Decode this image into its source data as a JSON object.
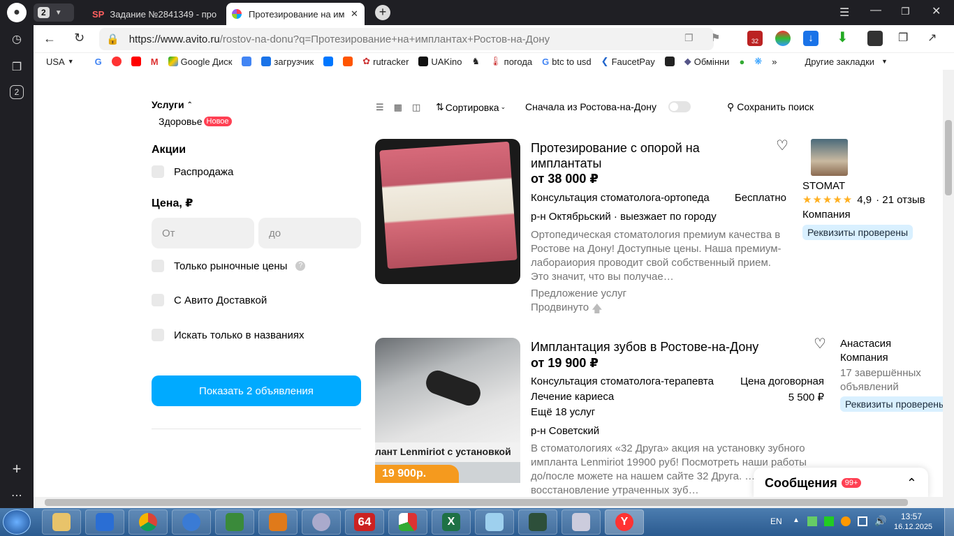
{
  "browser": {
    "tab_count": "2",
    "tabs": [
      {
        "label": "Задание №2841349 - про"
      },
      {
        "label": "Протезирование на им"
      }
    ],
    "url_domain": "https://www.avito.ru",
    "url_path": "/rostov-na-donu?q=Протезирование+на+имплантах+Ростов-на-Дону",
    "sidebar_badge": "2",
    "bookmarks": [
      "USA",
      "Google Диск",
      "загрузчик",
      "rutracker",
      "UAKino",
      "погода",
      "btc to usd",
      "FaucetPay",
      "Обмінни"
    ],
    "other_bookmarks": "Другие закладки",
    "ext_badge": "32"
  },
  "filters": {
    "services_label": "Услуги",
    "health_label": "Здоровье",
    "new_badge": "Новое",
    "promo_heading": "Акции",
    "sale_label": "Распродажа",
    "price_heading": "Цена, ₽",
    "price_from_placeholder": "От",
    "price_to_placeholder": "до",
    "market_only": "Только рыночные цены",
    "help_mark": "?",
    "avito_delivery": "С Авито Доставкой",
    "titles_only": "Искать только в названиях",
    "show_button": "Показать 2 объявления"
  },
  "listbar": {
    "sort_label": "Сортировка",
    "rostov_first": "Сначала из Ростова-на-Дону",
    "save_search": "Сохранить поиск"
  },
  "listings": [
    {
      "title_line1": "Протезирование с опорой на",
      "title_line2": "имплантаты",
      "price": "от 38 000 ₽",
      "service1": "Консультация стоматолога-ортопеда",
      "service1_price": "Бесплатно",
      "location": "р-н Октябрьский · выезжает по городу",
      "description": "Ортопедическая стоматология премиум качества в Ростове на Дону! Доступные цены. Наша премиум-лабораиория проводит свой собственный прием. Это значит, что вы получае…",
      "offer_type": "Предложение услуг",
      "promoted": "Продвинуто",
      "seller_name": "STOMAT",
      "rating": "4,9",
      "reviews": "· 21 отзыв",
      "seller_type": "Компания",
      "verified": "Реквизиты проверены"
    },
    {
      "title": "Имплантация зубов в Ростове-на-Дону",
      "price": "от 19 900 ₽",
      "service1": "Консультация стоматолога-терапевта",
      "service1_price": "Цена договорная",
      "service2": "Лечение кариеса",
      "service2_price": "5 500 ₽",
      "more_services": "Ещё 18 услуг",
      "location": "р-н Советский",
      "description": "В стоматологиях «32 Друга» акция на установку зубного импланта Lenmiriot 19900 руб! Посмотреть наши работы до/после можете на нашем сайте 32 Друга. … и надежное восстановление утраченных зуб…",
      "image_caption": "лант Lenmiriot с установкой",
      "image_price": "19 900р.",
      "seller_name": "Анастасия",
      "seller_type": "Компания",
      "completed": "17 завершённых объявлений",
      "verified": "Реквизиты проверены"
    }
  ],
  "messages_panel": {
    "label": "Сообщения",
    "badge": "99+"
  },
  "taskbar": {
    "lang": "EN",
    "time": "13:57",
    "date": "16.12.2025",
    "tile64": "64"
  },
  "colors": {
    "accent_blue": "#00aaff",
    "new_badge": "#ff4053",
    "star": "#ffb021"
  }
}
